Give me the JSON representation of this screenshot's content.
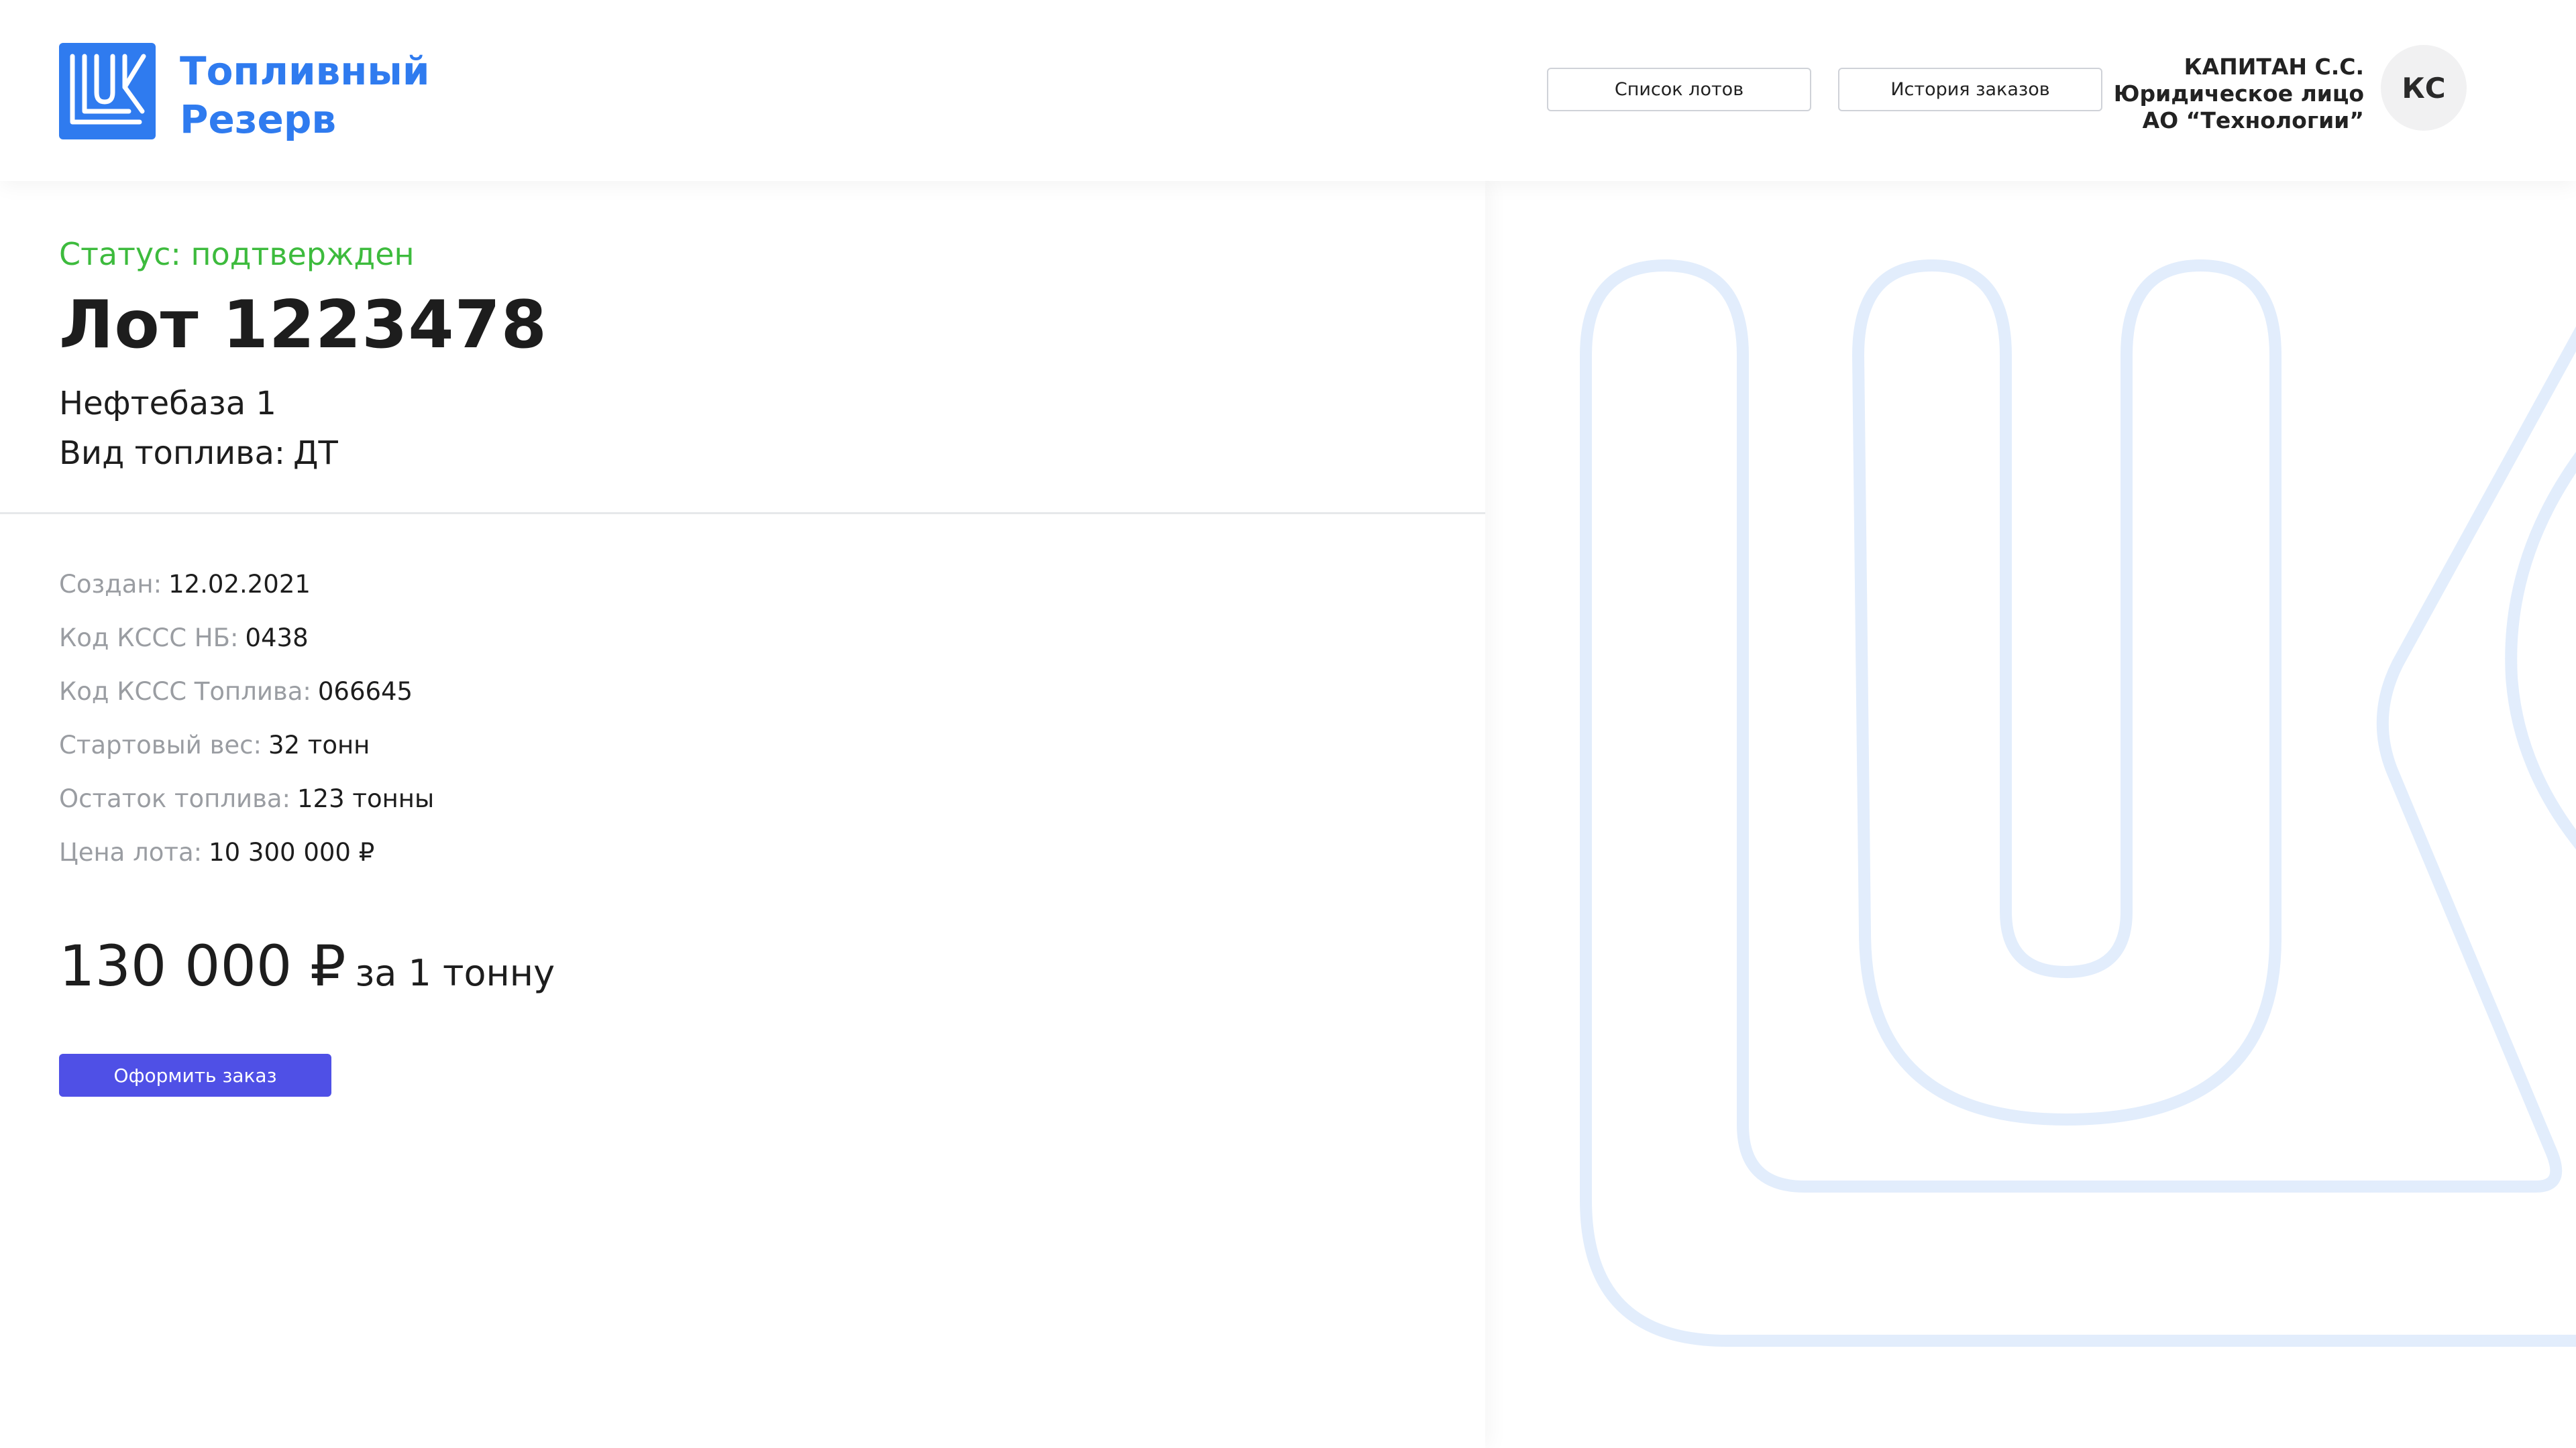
{
  "brand": {
    "line1": "Топливный",
    "line2": "Резерв",
    "color": "#2f7bef"
  },
  "nav": {
    "lots_label": "Список лотов",
    "history_label": "История заказов"
  },
  "user": {
    "name": "КАПИТАН С.С.",
    "type": "Юридическое лицо",
    "company": "АО “Технологии”",
    "initials": "КС"
  },
  "lot": {
    "status": "Статус: подтвержден",
    "status_color": "#3dbb3d",
    "title": "Лот 1223478",
    "depot": "Нефтебаза 1",
    "fuel_label": "Вид топлива:",
    "fuel_value": "ДТ",
    "details": [
      {
        "key": "Создан:",
        "value": "12.02.2021"
      },
      {
        "key": "Код КССС НБ:",
        "value": "0438"
      },
      {
        "key": "Код КССС Топлива:",
        "value": "066645"
      },
      {
        "key": "Стартовый вес:",
        "value": "32 тонн"
      },
      {
        "key": "Остаток топлива:",
        "value": "123 тонны"
      },
      {
        "key": "Цена лота:",
        "value": "10 300 000 ₽"
      }
    ],
    "price_value": "130 000 ₽",
    "price_unit": "за 1 тонну",
    "order_label": "Оформить заказ",
    "order_color": "#4f50e6"
  },
  "icons": {
    "logo": "lukoil-logo-icon",
    "background": "lukoil-outline-watermark"
  }
}
